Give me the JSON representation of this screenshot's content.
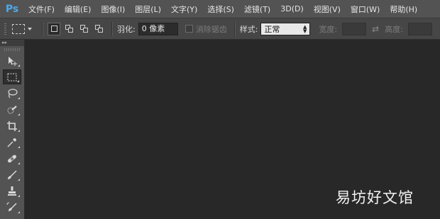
{
  "app": {
    "logo": "Ps"
  },
  "menu": [
    {
      "label": "文件(F)"
    },
    {
      "label": "编辑(E)"
    },
    {
      "label": "图像(I)"
    },
    {
      "label": "图层(L)"
    },
    {
      "label": "文字(Y)"
    },
    {
      "label": "选择(S)"
    },
    {
      "label": "滤镜(T)"
    },
    {
      "label": "3D(D)"
    },
    {
      "label": "视图(V)"
    },
    {
      "label": "窗口(W)"
    },
    {
      "label": "帮助(H)"
    }
  ],
  "options": {
    "feather_label": "羽化:",
    "feather_value": "0 像素",
    "antialias_label": "消除锯齿",
    "style_label": "样式:",
    "style_value": "正常",
    "width_label": "宽度:",
    "height_label": "高度:",
    "swap_icon": "swap-icon"
  },
  "toolpanel": {
    "header": "▸▸",
    "tools": [
      {
        "name": "move-tool",
        "icon": "move-icon"
      },
      {
        "name": "rect-marquee-tool",
        "icon": "rect-marquee-icon",
        "active": true
      },
      {
        "name": "lasso-tool",
        "icon": "lasso-icon"
      },
      {
        "name": "quick-select-tool",
        "icon": "quick-select-icon"
      },
      {
        "name": "crop-tool",
        "icon": "crop-icon"
      },
      {
        "name": "eyedropper-tool",
        "icon": "eyedropper-icon"
      },
      {
        "name": "healing-brush-tool",
        "icon": "bandage-icon"
      },
      {
        "name": "brush-tool",
        "icon": "brush-icon"
      },
      {
        "name": "clone-stamp-tool",
        "icon": "stamp-icon"
      },
      {
        "name": "history-brush-tool",
        "icon": "history-brush-icon"
      }
    ]
  },
  "watermark": "易坊好文馆"
}
